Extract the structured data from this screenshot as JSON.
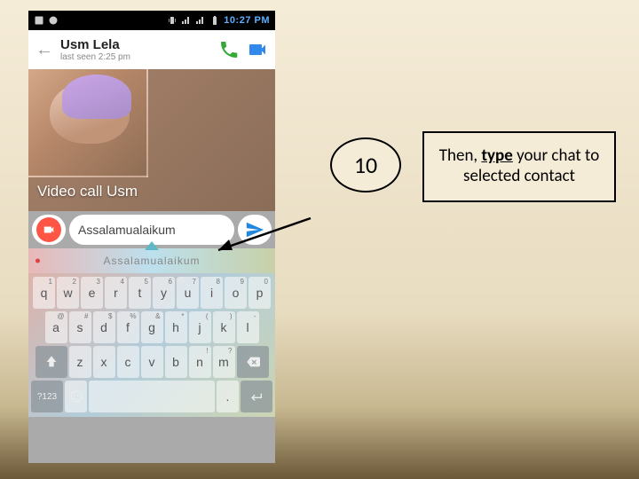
{
  "status_bar": {
    "time": "10:27 PM"
  },
  "chat_header": {
    "contact_name": "Usm Lela",
    "last_seen": "last seen 2:25 pm"
  },
  "call_overlay": {
    "label": "Video call Usm"
  },
  "input": {
    "text": "Assalamualaikum",
    "hint": "Assalamualaikum"
  },
  "keyboard": {
    "row1": [
      {
        "k": "q",
        "s": "1"
      },
      {
        "k": "w",
        "s": "2"
      },
      {
        "k": "e",
        "s": "3"
      },
      {
        "k": "r",
        "s": "4"
      },
      {
        "k": "t",
        "s": "5"
      },
      {
        "k": "y",
        "s": "6"
      },
      {
        "k": "u",
        "s": "7"
      },
      {
        "k": "i",
        "s": "8"
      },
      {
        "k": "o",
        "s": "9"
      },
      {
        "k": "p",
        "s": "0"
      }
    ],
    "row2": [
      {
        "k": "a",
        "s": "@"
      },
      {
        "k": "s",
        "s": "#"
      },
      {
        "k": "d",
        "s": "$"
      },
      {
        "k": "f",
        "s": "%"
      },
      {
        "k": "g",
        "s": "&"
      },
      {
        "k": "h",
        "s": "*"
      },
      {
        "k": "j",
        "s": "("
      },
      {
        "k": "k",
        "s": ")"
      },
      {
        "k": "l",
        "s": "-"
      }
    ],
    "row3": [
      {
        "k": "z",
        "s": ""
      },
      {
        "k": "x",
        "s": ""
      },
      {
        "k": "c",
        "s": ""
      },
      {
        "k": "v",
        "s": ""
      },
      {
        "k": "b",
        "s": ""
      },
      {
        "k": "n",
        "s": "!"
      },
      {
        "k": "m",
        "s": "?"
      }
    ],
    "sym_key": "?123"
  },
  "step": {
    "number": "10"
  },
  "instruction": {
    "pre": "Then, ",
    "bold": "type",
    "post": " your chat to selected contact"
  }
}
